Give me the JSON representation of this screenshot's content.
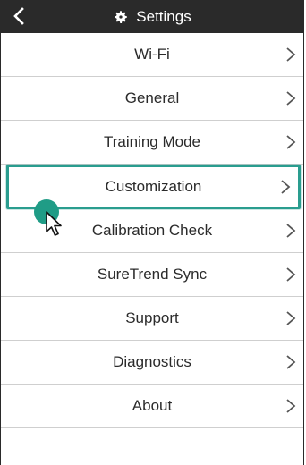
{
  "header": {
    "title": "Settings",
    "back_icon": "chevron-left-icon",
    "title_icon": "gear-icon"
  },
  "menu": {
    "items": [
      {
        "label": "Wi-Fi"
      },
      {
        "label": "General"
      },
      {
        "label": "Training Mode"
      },
      {
        "label": "Customization",
        "selected": true
      },
      {
        "label": "Calibration Check"
      },
      {
        "label": "SureTrend Sync"
      },
      {
        "label": "Support"
      },
      {
        "label": "Diagnostics"
      },
      {
        "label": "About"
      }
    ],
    "chevron_icon": "chevron-right-icon"
  },
  "colors": {
    "header_bg": "#2a2a2a",
    "highlight": "#2a9d8f",
    "text": "#2b2b2b",
    "divider": "#cfcfcf"
  }
}
